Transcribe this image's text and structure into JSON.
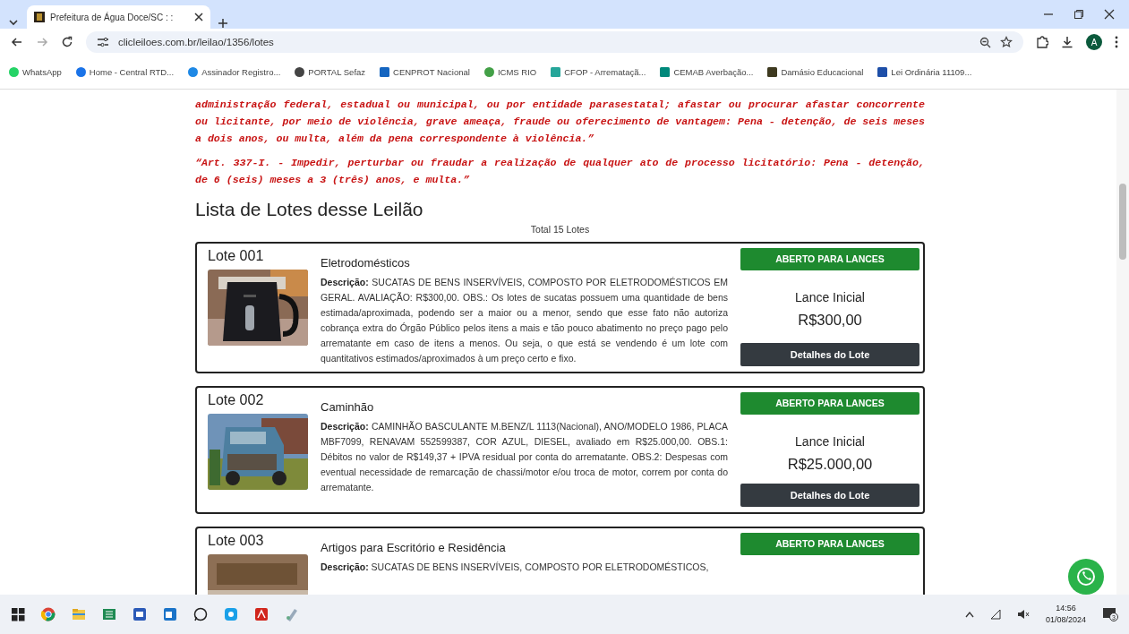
{
  "browser": {
    "tab_title": "Prefeitura de Água Doce/SC : :",
    "url": "clicleiloes.com.br/leilao/1356/lotes",
    "profile_initial": "A",
    "bookmarks": [
      {
        "label": "WhatsApp",
        "color": "#25d366"
      },
      {
        "label": "Home - Central RTD...",
        "color": "#1a73e8"
      },
      {
        "label": "Assinador Registro...",
        "color": "#1e88e5"
      },
      {
        "label": "PORTAL Sefaz",
        "color": "#444444"
      },
      {
        "label": "CENPROT Nacional",
        "color": "#1565c0"
      },
      {
        "label": "ICMS RIO",
        "color": "#43a047"
      },
      {
        "label": "CFOP - Arremataçã...",
        "color": "#26a69a"
      },
      {
        "label": "CEMAB Averbação...",
        "color": "#00897b"
      },
      {
        "label": "Damásio Educacional",
        "color": "#3e3a20"
      },
      {
        "label": "Lei Ordinária 11109...",
        "color": "#1e4fa8"
      }
    ]
  },
  "page": {
    "legal_paragraphs": [
      "administração federal, estadual ou municipal, ou por entidade parasestatal; afastar ou procurar afastar concorrente ou licitante, por meio de violência, grave ameaça, fraude ou oferecimento de vantagem: Pena - detenção, de seis meses a dois anos, ou multa, além da pena correspondente à violência.”",
      "“Art. 337-I. - Impedir, perturbar ou fraudar a realização de qualquer ato de processo licitatório: Pena - detenção, de 6 (seis) meses a 3 (três) anos, e multa.”"
    ],
    "heading": "Lista de Lotes desse Leilão",
    "total": "Total 15 Lotes",
    "lots": [
      {
        "number": "Lote 001",
        "title": "Eletrodomésticos",
        "description": "**Descrição:** SUCATAS DE BENS INSERVÍVEIS, COMPOSTO POR ELETRODOMÉSTICOS EM GERAL. AVALIAÇÃO: R$300,00. OBS.: Os lotes de sucatas possuem uma quantidade de bens estimada/aproximada, podendo ser a maior ou a menor, sendo que esse fato não autoriza cobrança extra do Órgão Público pelos itens a mais e tão pouco abatimento no preço pago pelo arrematante em caso de itens a menos. Ou seja, o que está se vendendo é um lote com quantitativos estimados/aproximados à um preço certo e fixo.",
        "status": "ABERTO PARA LANCES",
        "price_label": "Lance Inicial",
        "price": "R$300,00",
        "details_button": "Detalhes do Lote"
      },
      {
        "number": "Lote 002",
        "title": "Caminhão",
        "description": "**Descrição:** CAMINHÃO BASCULANTE M.BENZ/L 1113(Nacional), ANO/MODELO 1986, PLACA MBF7099, RENAVAM 552599387, COR AZUL, DIESEL, avaliado em R$25.000,00. OBS.1: Débitos no valor de R$149,37 + IPVA residual por conta do arrematante. OBS.2: Despesas com eventual necessidade de remarcação de chassi/motor e/ou troca de motor, correm por conta do arrematante.",
        "status": "ABERTO PARA LANCES",
        "price_label": "Lance Inicial",
        "price": "R$25.000,00",
        "details_button": "Detalhes do Lote"
      },
      {
        "number": "Lote 003",
        "title": "Artigos para Escritório e Residência",
        "description": "**Descrição:** SUCATAS DE BENS INSERVÍVEIS, COMPOSTO POR ELETRODOMÉSTICOS,",
        "status": "ABERTO PARA LANCES"
      }
    ]
  },
  "taskbar": {
    "time": "14:56",
    "date": "01/08/2024",
    "notifications": "3"
  }
}
